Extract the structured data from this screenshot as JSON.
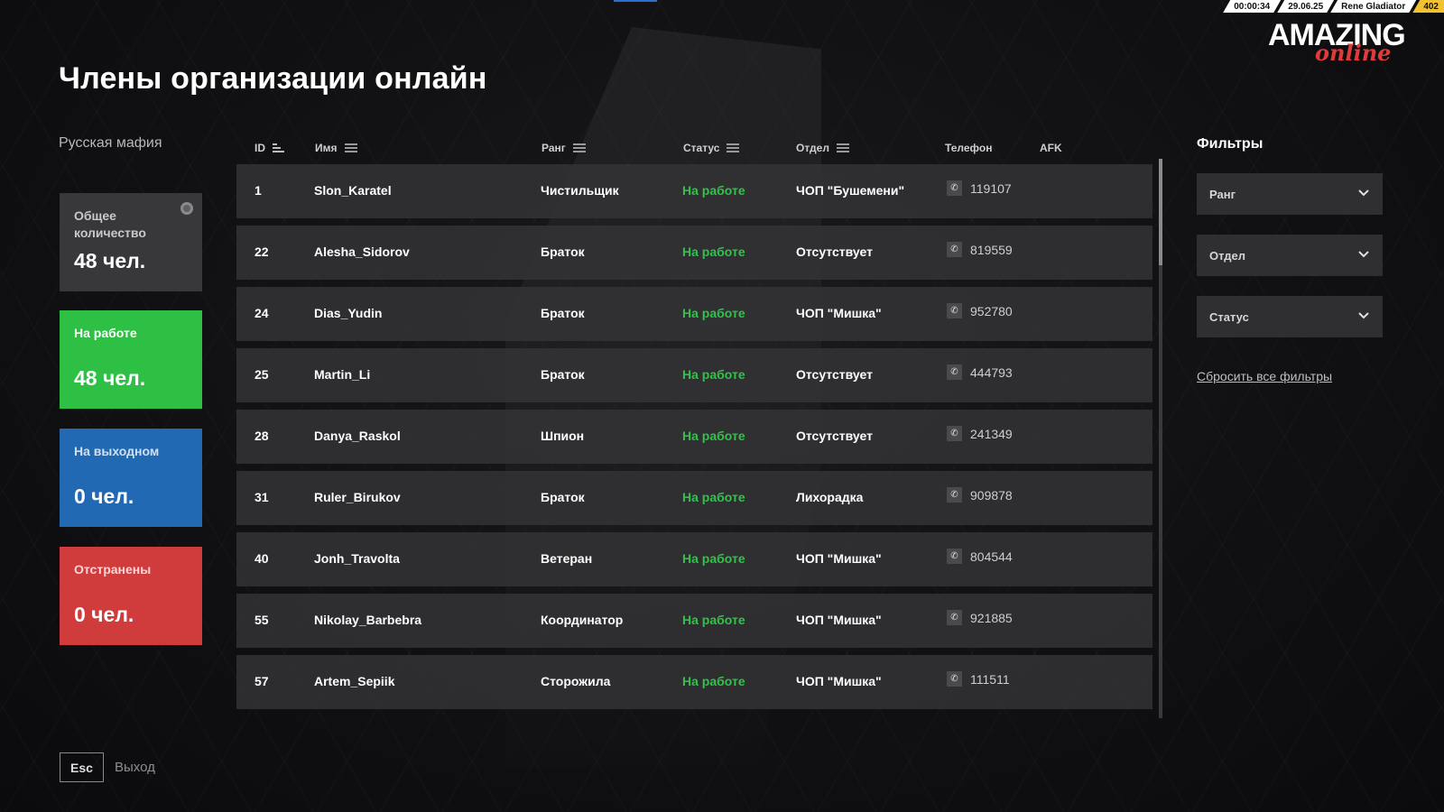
{
  "hud": {
    "time": "00:00:34",
    "date": "29.06.25",
    "player": "Rene Gladiator",
    "level": "402"
  },
  "logo": {
    "main": "AMAZING",
    "sub": "online"
  },
  "page_title": "Члены организации онлайн",
  "org_name": "Русская мафия",
  "stats": {
    "total": {
      "label": "Общее количество",
      "value": "48 чел."
    },
    "at_work": {
      "label": "На работе",
      "value": "48 чел."
    },
    "day_off": {
      "label": "На выходном",
      "value": "0 чел."
    },
    "suspended": {
      "label": "Отстранены",
      "value": "0 чел."
    }
  },
  "columns": {
    "id": "ID",
    "name": "Имя",
    "rank": "Ранг",
    "status": "Статус",
    "dept": "Отдел",
    "phone": "Телефон",
    "afk": "AFK"
  },
  "members": [
    {
      "id": "1",
      "name": "Slon_Karatel",
      "rank": "Чистильщик",
      "status": "На работе",
      "dept": "ЧОП \"Бушемени\"",
      "phone": "119107"
    },
    {
      "id": "22",
      "name": "Alesha_Sidorov",
      "rank": "Браток",
      "status": "На работе",
      "dept": "Отсутствует",
      "phone": "819559"
    },
    {
      "id": "24",
      "name": "Dias_Yudin",
      "rank": "Браток",
      "status": "На работе",
      "dept": "ЧОП \"Мишка\"",
      "phone": "952780"
    },
    {
      "id": "25",
      "name": "Martin_Li",
      "rank": "Браток",
      "status": "На работе",
      "dept": "Отсутствует",
      "phone": "444793"
    },
    {
      "id": "28",
      "name": "Danya_Raskol",
      "rank": "Шпион",
      "status": "На работе",
      "dept": "Отсутствует",
      "phone": "241349"
    },
    {
      "id": "31",
      "name": "Ruler_Birukov",
      "rank": "Браток",
      "status": "На работе",
      "dept": "Лихорадка",
      "phone": "909878"
    },
    {
      "id": "40",
      "name": "Jonh_Travolta",
      "rank": "Ветеран",
      "status": "На работе",
      "dept": "ЧОП \"Мишка\"",
      "phone": "804544"
    },
    {
      "id": "55",
      "name": "Nikolay_Barbebra",
      "rank": "Координатор",
      "status": "На работе",
      "dept": "ЧОП \"Мишка\"",
      "phone": "921885"
    },
    {
      "id": "57",
      "name": "Artem_Sepiik",
      "rank": "Сторожила",
      "status": "На работе",
      "dept": "ЧОП \"Мишка\"",
      "phone": "111511"
    }
  ],
  "filters": {
    "title": "Фильтры",
    "rank": "Ранг",
    "dept": "Отдел",
    "status": "Статус",
    "reset": "Сбросить все фильтры"
  },
  "exit": {
    "key": "Esc",
    "label": "Выход"
  }
}
